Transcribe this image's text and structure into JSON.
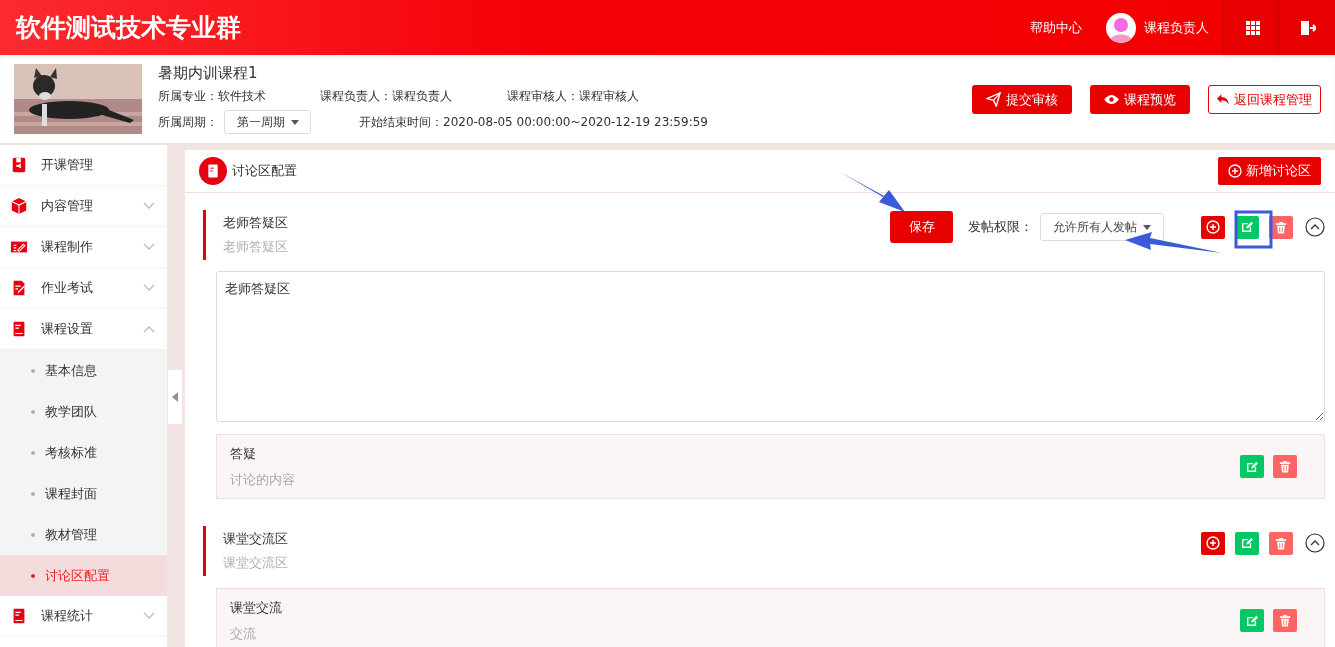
{
  "header": {
    "title": "软件测试技术专业群",
    "help": "帮助中心",
    "user": "课程负责人"
  },
  "course": {
    "name": "暑期内训课程1",
    "major_label": "所属专业：",
    "major": "软件技术",
    "owner_label": "课程负责人：",
    "owner": "课程负责人",
    "reviewer_label": "课程审核人：",
    "reviewer": "课程审核人",
    "period_label": "所属周期：",
    "period": "第一周期",
    "time_label": "开始结束时间：",
    "time": "2020-08-05 00:00:00~2020-12-19 23:59:59"
  },
  "actions": [
    {
      "label": "提交审核",
      "kind": "submit"
    },
    {
      "label": "课程预览",
      "kind": "preview"
    },
    {
      "label": "返回课程管理",
      "kind": "back"
    }
  ],
  "sidebar": {
    "items": [
      {
        "label": "开课管理"
      },
      {
        "label": "内容管理",
        "expanded": false
      },
      {
        "label": "课程制作",
        "expanded": false
      },
      {
        "label": "作业考试",
        "expanded": false
      },
      {
        "label": "课程设置",
        "expanded": true,
        "children": [
          {
            "label": "基本信息",
            "selected": false
          },
          {
            "label": "教学团队",
            "selected": false
          },
          {
            "label": "考核标准",
            "selected": false
          },
          {
            "label": "课程封面",
            "selected": false
          },
          {
            "label": "教材管理",
            "selected": false
          },
          {
            "label": "讨论区配置",
            "selected": true
          }
        ]
      },
      {
        "label": "课程统计",
        "expanded": false
      }
    ]
  },
  "panel": {
    "title": "讨论区配置",
    "add_button": "新增讨论区",
    "sections": [
      {
        "title": "老师答疑区",
        "subtitle": "老师答疑区",
        "editing": true,
        "save": "保存",
        "permission_label": "发帖权限：",
        "permission": "允许所有人发帖",
        "description": "老师答疑区",
        "topics": [
          {
            "title": "答疑",
            "subtitle": "讨论的内容"
          }
        ]
      },
      {
        "title": "课堂交流区",
        "subtitle": "课堂交流区",
        "editing": false,
        "topics": [
          {
            "title": "课堂交流",
            "subtitle": "交流"
          }
        ]
      }
    ]
  }
}
